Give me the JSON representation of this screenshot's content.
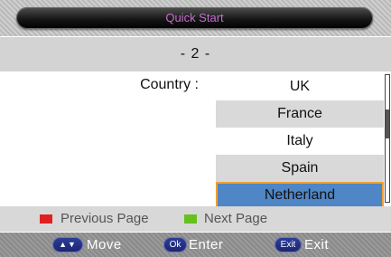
{
  "header": {
    "title": "Quick Start"
  },
  "page_indicator": "- 2 -",
  "country": {
    "label": "Country :",
    "options": [
      {
        "name": "UK",
        "shaded": false,
        "selected": false
      },
      {
        "name": "France",
        "shaded": true,
        "selected": false
      },
      {
        "name": "Italy",
        "shaded": false,
        "selected": false
      },
      {
        "name": "Spain",
        "shaded": true,
        "selected": false
      },
      {
        "name": "Netherland",
        "shaded": false,
        "selected": true
      }
    ]
  },
  "legend": {
    "previous": {
      "label": "Previous Page",
      "color": "#e02020"
    },
    "next": {
      "label": "Next Page",
      "color": "#66c020"
    }
  },
  "footer": {
    "move": {
      "key": "▲▼",
      "label": "Move",
      "icon": "up-down-arrows-icon"
    },
    "enter": {
      "key": "Ok",
      "label": "Enter"
    },
    "exit": {
      "key": "Exit",
      "label": "Exit"
    }
  },
  "colors": {
    "title_text": "#c86ad2",
    "selection_fill": "#4f86c6",
    "selection_border": "#f0a030",
    "key_blue": "#1a2470"
  }
}
